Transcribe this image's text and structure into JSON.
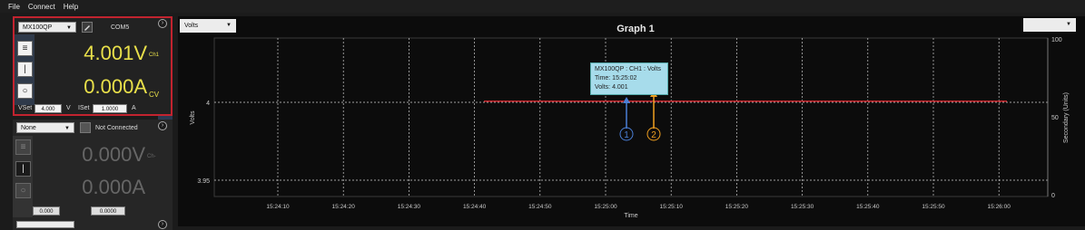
{
  "menu": {
    "file": "File",
    "connect": "Connect",
    "help": "Help"
  },
  "ch1": {
    "model": "MX100QP",
    "port": "COM5",
    "voltage": "4.001V",
    "voltage_tag": "Ch1",
    "current": "0.000A",
    "mode": "CV",
    "vset_label": "VSet",
    "vset_value": "4.000",
    "v_unit": "V",
    "iset_label": "ISet",
    "iset_value": "1.0000",
    "a_unit": "A"
  },
  "ch2": {
    "model": "None",
    "status": "Not Connected",
    "voltage": "0.000V",
    "voltage_tag": "Ch-",
    "current": "0.000A",
    "vset_value": "0.000",
    "iset_value": "0.0000"
  },
  "graph": {
    "selector": "Volts",
    "title": "Graph 1",
    "ylabel": "Volts",
    "y2label": "Secondary (Units)",
    "xlabel": "Time",
    "yticks": [
      "4",
      "3.95"
    ],
    "y2ticks": [
      "100",
      "50",
      "0"
    ],
    "xticks": [
      "15:24:10",
      "15:24:20",
      "15:24:30",
      "15:24:40",
      "15:24:50",
      "15:25:00",
      "15:25:10",
      "15:25:20",
      "15:25:30",
      "15:25:40",
      "15:25:50",
      "15:26:00"
    ],
    "series_color": "#c8262c"
  },
  "tooltip": {
    "line1": "MX100QP : CH1 : Volts",
    "line2": "Time: 15:25:02",
    "line3": "Volts: 4.001"
  },
  "annotations": {
    "one": "1",
    "two": "2",
    "one_color": "#4a7fd6",
    "two_color": "#f0a020"
  }
}
